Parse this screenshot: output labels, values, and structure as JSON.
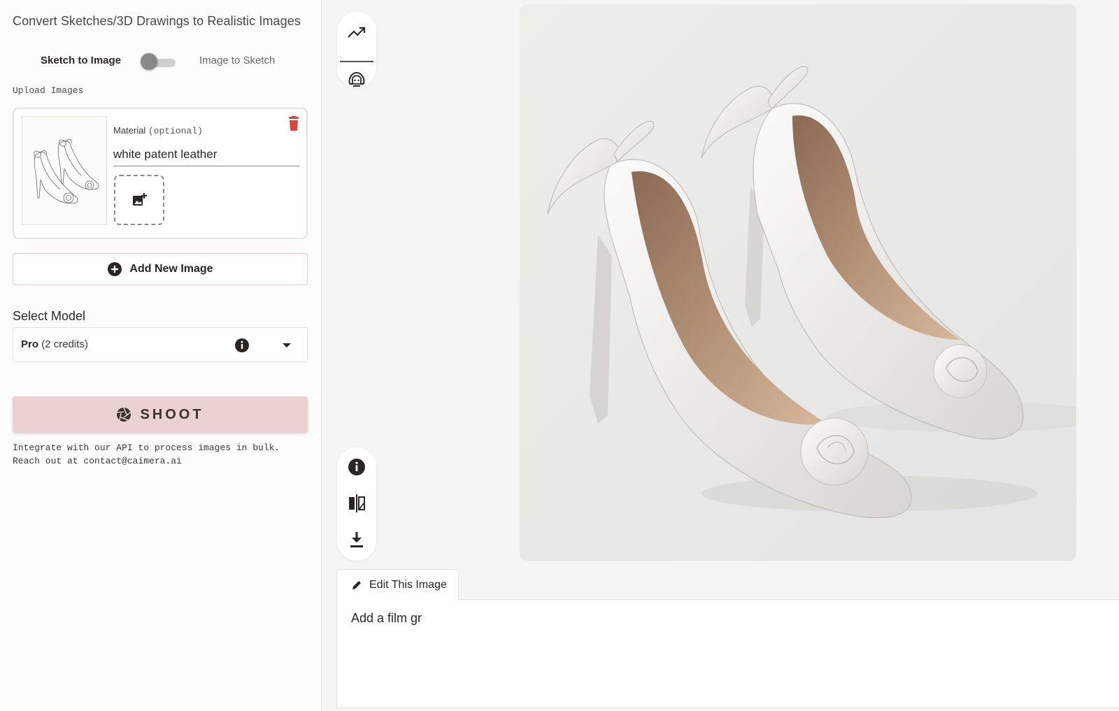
{
  "app": {
    "title": "Convert Sketches/3D Drawings to Realistic Images"
  },
  "mode_toggle": {
    "left_label": "Sketch to Image",
    "right_label": "Image to Sketch",
    "active": "left"
  },
  "upload": {
    "section_label": "Upload Images",
    "material_label": "Material",
    "material_optional": "(optional)",
    "material_value": "white patent leather",
    "add_new_image_label": "Add New Image"
  },
  "model": {
    "section_label": "Select Model",
    "selected_name": "Pro",
    "selected_credits": "(2 credits)"
  },
  "shoot": {
    "label": "SHOOT"
  },
  "api_note": {
    "line1": "Integrate with our API to process images in bulk.",
    "line2": "Reach out at contact@caimera.ai"
  },
  "edit": {
    "tab_label": "Edit This Image",
    "input_value": "Add a film gr"
  },
  "icons": {
    "toolbar_top": [
      "trending-up-icon",
      "face-retouch-icon"
    ],
    "toolbar_bottom": [
      "info-icon",
      "compare-icon",
      "download-icon"
    ]
  },
  "colors": {
    "accent_pink": "#ebd1d2",
    "border_pink": "#e8c9cc",
    "delete_red": "#d9463c",
    "text_dark": "#2a2624"
  }
}
